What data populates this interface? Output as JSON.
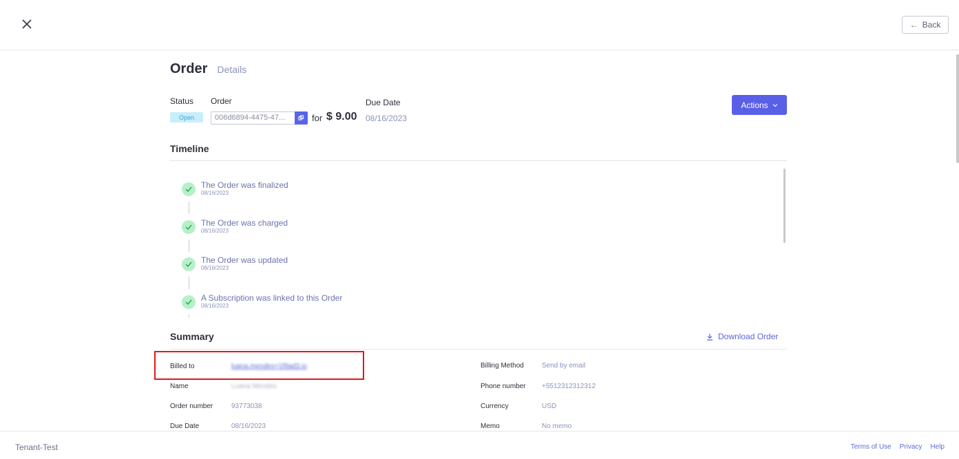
{
  "header": {
    "back_label": "Back"
  },
  "page": {
    "title": "Order",
    "subtitle": "Details"
  },
  "order_info": {
    "status_label": "Status",
    "status_value": "Open",
    "order_label": "Order",
    "order_id": "006d6894-4475-47...",
    "for_text": "for",
    "amount": "$ 9.00",
    "due_date_label": "Due Date",
    "due_date_value": "08/16/2023",
    "actions_label": "Actions"
  },
  "timeline": {
    "title": "Timeline",
    "events": [
      {
        "text": "The Order was finalized",
        "date": "08/16/2023"
      },
      {
        "text": "The Order was charged",
        "date": "08/16/2023"
      },
      {
        "text": "The Order was updated",
        "date": "08/16/2023"
      },
      {
        "text": "A Subscription was linked to this Order",
        "date": "08/16/2023"
      }
    ]
  },
  "summary": {
    "title": "Summary",
    "download_label": "Download Order",
    "left": [
      {
        "label": "Billed to",
        "value": "luana.mendes+1f9ad3.io"
      },
      {
        "label": "Name",
        "value": "Luana Mendes"
      },
      {
        "label": "Order number",
        "value": "93773038"
      },
      {
        "label": "Due Date",
        "value": "08/16/2023"
      }
    ],
    "right": [
      {
        "label": "Billing Method",
        "value": "Send by email"
      },
      {
        "label": "Phone number",
        "value": "+5512312312312"
      },
      {
        "label": "Currency",
        "value": "USD"
      },
      {
        "label": "Memo",
        "value": "No memo"
      }
    ]
  },
  "footer": {
    "tenant": "Tenant-Test",
    "links": [
      "Terms of Use",
      "Privacy",
      "Help"
    ]
  },
  "colors": {
    "accent": "#5a5fe8",
    "status_open_bg": "#c8eefb",
    "timeline_check_bg": "#b6f0c8",
    "highlight": "#e0161d"
  }
}
